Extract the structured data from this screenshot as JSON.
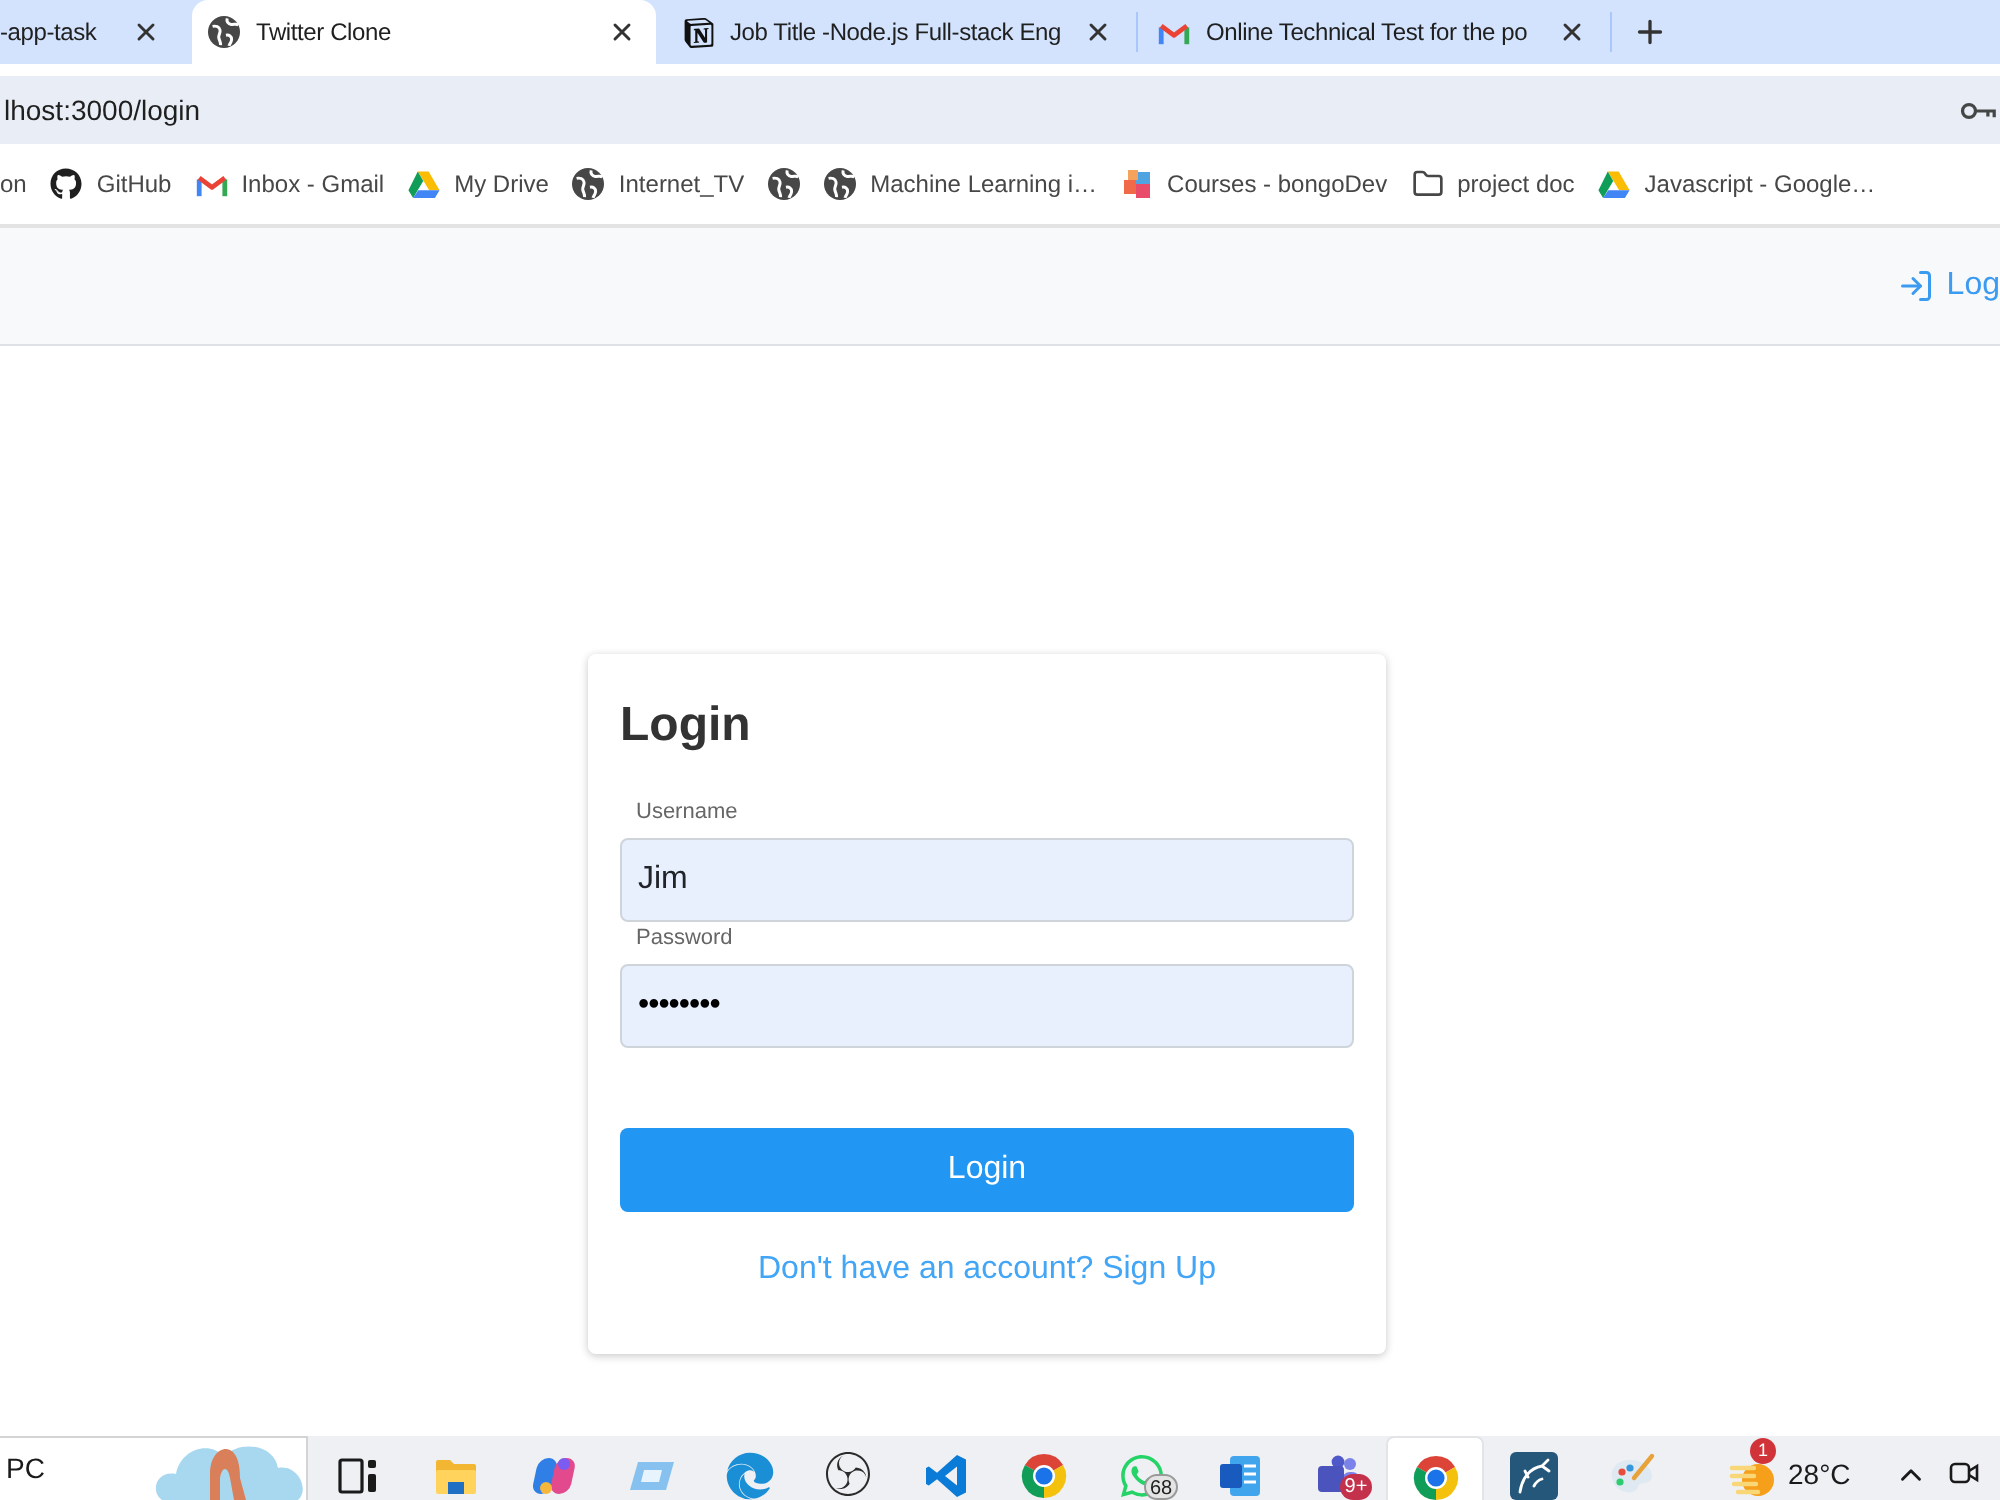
{
  "browser": {
    "tabs": [
      {
        "title": "-app-task",
        "kind": "none",
        "selected": false
      },
      {
        "title": "Twitter Clone",
        "kind": "globe",
        "selected": true
      },
      {
        "title": "Job Title -Node.js Full-stack Eng",
        "kind": "n-square",
        "selected": false
      },
      {
        "title": "Online Technical Test for the po",
        "kind": "m-mail",
        "selected": false
      }
    ],
    "address": "lhost:3000/login",
    "bookmarks": [
      {
        "label": "on",
        "kind": "none"
      },
      {
        "label": "GitHub",
        "kind": "cat"
      },
      {
        "label": "Inbox - Gmail",
        "kind": "m-mail"
      },
      {
        "label": "My Drive",
        "kind": "triangle"
      },
      {
        "label": "Internet_TV",
        "kind": "globe"
      },
      {
        "kind": "globe"
      },
      {
        "label": "Machine Learning i…",
        "kind": "globe"
      },
      {
        "label": "Courses - bongoDev",
        "kind": "cube"
      },
      {
        "label": "project doc",
        "kind": "folder"
      },
      {
        "label": "Javascript - Google…",
        "kind": "triangle"
      }
    ]
  },
  "app_header": {
    "login_link": "Log"
  },
  "login_form": {
    "title": "Login",
    "fields": [
      {
        "label": "Username",
        "value": "Jim",
        "kind": "text"
      },
      {
        "label": "Password",
        "value": "••••••••",
        "kind": "password"
      }
    ],
    "submit": "Login",
    "signup_link": "Don't have an account? Sign Up"
  },
  "taskbar": {
    "search_text": "PC",
    "apps": [
      {
        "kind": "task-view",
        "selected": false
      },
      {
        "kind": "folder",
        "selected": false
      },
      {
        "kind": "petals",
        "selected": false
      },
      {
        "kind": "window",
        "selected": false
      },
      {
        "kind": "wave",
        "selected": false
      },
      {
        "kind": "aperture",
        "selected": false
      },
      {
        "kind": "ribbon",
        "selected": false
      },
      {
        "kind": "color-wheel",
        "selected": false
      },
      {
        "kind": "chat",
        "badge": "68",
        "selected": false
      },
      {
        "kind": "document",
        "selected": false
      },
      {
        "kind": "people",
        "badge": "9+",
        "selected": false
      },
      {
        "kind": "color-wheel",
        "selected": true
      },
      {
        "kind": "curve-tile",
        "selected": false
      },
      {
        "kind": "palette",
        "selected": false
      }
    ],
    "weather": {
      "badge": "1",
      "temperature": "28°C"
    }
  }
}
